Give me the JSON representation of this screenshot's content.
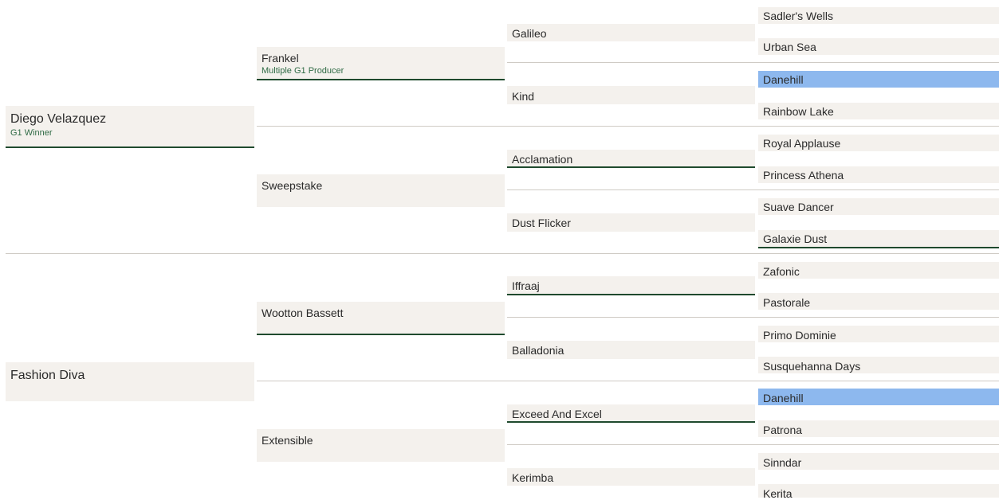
{
  "pedigree": {
    "gen1": [
      {
        "name": "Diego Velazquez",
        "note": "G1 Winner"
      },
      {
        "name": "Fashion Diva"
      }
    ],
    "gen2": [
      {
        "name": "Frankel",
        "note": "Multiple G1 Producer"
      },
      {
        "name": "Sweepstake"
      },
      {
        "name": "Wootton Bassett"
      },
      {
        "name": "Extensible"
      }
    ],
    "gen3": [
      {
        "name": "Galileo"
      },
      {
        "name": "Kind"
      },
      {
        "name": "Acclamation"
      },
      {
        "name": "Dust Flicker"
      },
      {
        "name": "Iffraaj"
      },
      {
        "name": "Balladonia"
      },
      {
        "name": "Exceed And Excel"
      },
      {
        "name": "Kerimba"
      }
    ],
    "gen4": [
      {
        "name": "Sadler's Wells"
      },
      {
        "name": "Urban Sea"
      },
      {
        "name": "Danehill"
      },
      {
        "name": "Rainbow Lake"
      },
      {
        "name": "Royal Applause"
      },
      {
        "name": "Princess Athena"
      },
      {
        "name": "Suave Dancer"
      },
      {
        "name": "Galaxie Dust"
      },
      {
        "name": "Zafonic"
      },
      {
        "name": "Pastorale"
      },
      {
        "name": "Primo Dominie"
      },
      {
        "name": "Susquehanna Days"
      },
      {
        "name": "Danehill"
      },
      {
        "name": "Patrona"
      },
      {
        "name": "Sinndar"
      },
      {
        "name": "Kerita"
      }
    ]
  },
  "colors": {
    "cell_bg": "#f4f1ed",
    "highlight": "#8db8ee",
    "accent_green": "#1f4a2e",
    "note_green": "#2f6b45"
  }
}
